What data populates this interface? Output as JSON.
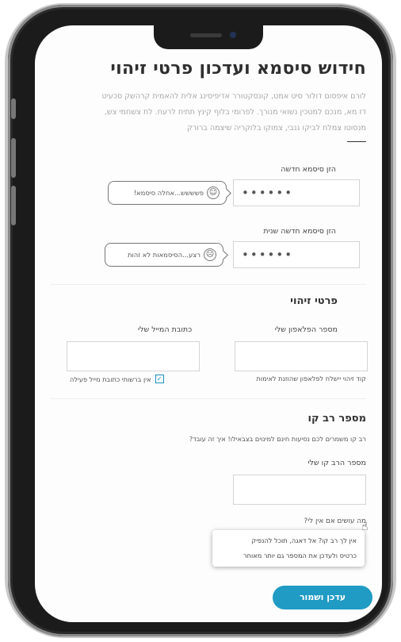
{
  "page": {
    "title": "חידוש סיסמא ועדכון פרטי זיהוי",
    "intro_lines": [
      "לורם איפסום דולור סיט אמט, קונסקטורר אדיפיסינג אלית להאמית קרהשק סכעיט",
      "דז מא, מנכם למטכין נשואי מנורך. לפרומי בלוף קינץ תתיח לרעח. לת צשחמי צש,",
      "מנסוטו צמלח לביקו ננבי, צמוקו בלוקריה שיצמה ברורק"
    ]
  },
  "password": {
    "new_label": "הזן סיסמא חדשה",
    "new_value": "••••••",
    "new_bubble": "פשששש...אחלה סיסמא!",
    "new_face": "☺",
    "confirm_label": "הזן סיסמא חדשה שנית",
    "confirm_value": "••••••",
    "confirm_bubble": "רצע...הסיסמאות לא זהות",
    "confirm_face": "☹"
  },
  "identity": {
    "title": "פרטי זיהוי",
    "phone_label": "מספר הפלאפון שלי",
    "phone_note": "קוד זיהוי יישלח לפלאפון שהוזנת לאימות",
    "email_label": "כתובת המייל שלי",
    "email_checkbox_label": "אין ברשותי כתובת מייל פעילה",
    "checkbox_mark": "✓"
  },
  "rav_kav": {
    "title": "מספר רב קו",
    "description": "רב קו משמרים לכם נסיעות חינם למינוים בצבאילו! איך זה עובד?",
    "number_label": "מספר הרב קו שלי",
    "help_link": "מה עושים אם אין לי?",
    "tooltip_lines": [
      "אין לך רב קו? אל דאגה, תוכל להנפיק",
      "כרטיס ולעדכן את המספר גם יותר מאוחר"
    ]
  },
  "actions": {
    "save_label": "עדכן ושמור"
  },
  "icons": {
    "cursor": "☝"
  },
  "colors": {
    "accent": "#1f9bc4",
    "phone_frame": "#1b1b1b"
  }
}
